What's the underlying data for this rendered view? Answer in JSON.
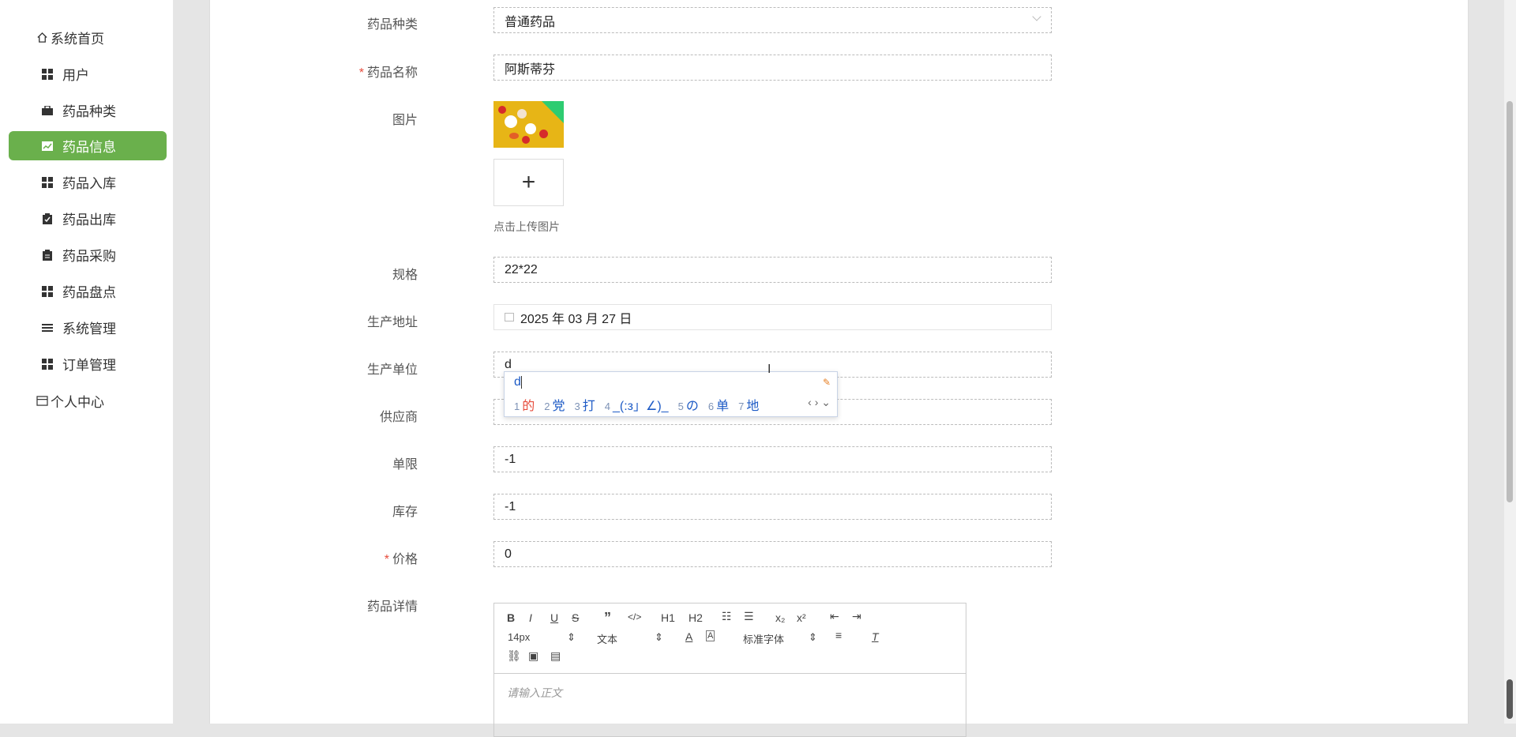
{
  "sidebar": {
    "items": [
      {
        "label": "系统首页",
        "icon": "home-icon"
      },
      {
        "label": "用户",
        "icon": "grid-icon"
      },
      {
        "label": "药品种类",
        "icon": "briefcase-icon"
      },
      {
        "label": "药品信息",
        "icon": "chart-icon"
      },
      {
        "label": "药品入库",
        "icon": "grid-icon"
      },
      {
        "label": "药品出库",
        "icon": "clipboard-check-icon"
      },
      {
        "label": "药品采购",
        "icon": "clipboard-icon"
      },
      {
        "label": "药品盘点",
        "icon": "grid-icon"
      },
      {
        "label": "系统管理",
        "icon": "list-icon"
      },
      {
        "label": "订单管理",
        "icon": "grid-icon"
      },
      {
        "label": "个人中心",
        "icon": "card-icon"
      }
    ]
  },
  "form": {
    "category": {
      "label": "药品种类",
      "value": "普通药品"
    },
    "name": {
      "label": "药品名称",
      "value": "阿斯蒂芬",
      "required_mark": "*"
    },
    "image": {
      "label": "图片",
      "upload_symbol": "+",
      "upload_hint": "点击上传图片"
    },
    "spec": {
      "label": "规格",
      "value": "22*22"
    },
    "address": {
      "label": "生产地址",
      "value": "2025 年 03 月 27 日"
    },
    "unit": {
      "label": "生产单位",
      "value": "d"
    },
    "supplier": {
      "label": "供应商",
      "value": ""
    },
    "limit": {
      "label": "单限",
      "value": "-1"
    },
    "stock": {
      "label": "库存",
      "value": "-1"
    },
    "price": {
      "label": "价格",
      "value": "0",
      "required_mark": "*"
    },
    "detail": {
      "label": "药品详情",
      "placeholder": "请输入正文"
    }
  },
  "ime": {
    "composition": "d",
    "candidates": [
      {
        "n": "1",
        "text": "的"
      },
      {
        "n": "2",
        "text": "党"
      },
      {
        "n": "3",
        "text": "打"
      },
      {
        "n": "4",
        "text": "_(:з」∠)_"
      },
      {
        "n": "5",
        "text": "の"
      },
      {
        "n": "6",
        "text": "单"
      },
      {
        "n": "7",
        "text": "地"
      }
    ]
  },
  "editor": {
    "font_size": "14px",
    "text_type": "文本",
    "font_family": "标准字体",
    "h1": "H1",
    "h2": "H2",
    "sub": "x₂",
    "sup": "x²"
  },
  "colors": {
    "active": "#6ab04c",
    "required": "#e74c3c",
    "ime_text": "#1e5bc6"
  }
}
